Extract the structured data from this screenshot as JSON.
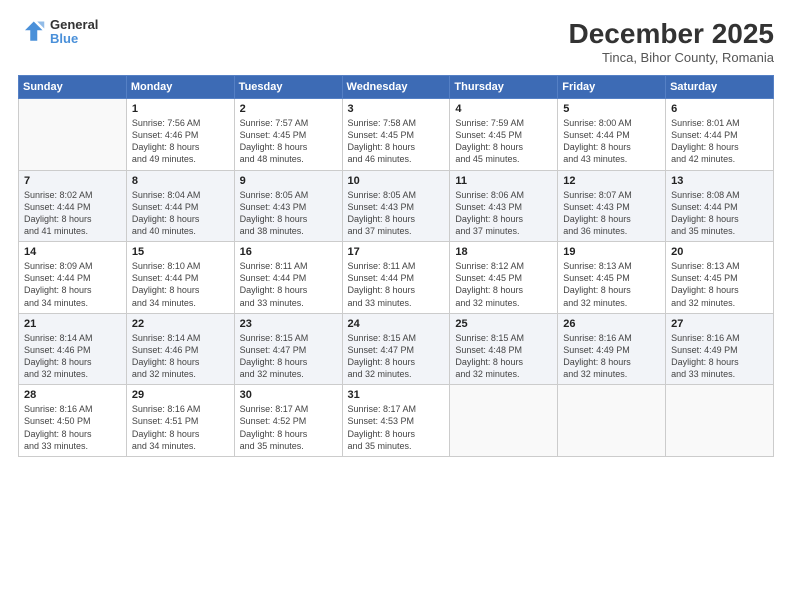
{
  "header": {
    "logo": {
      "general": "General",
      "blue": "Blue"
    },
    "title": "December 2025",
    "location": "Tinca, Bihor County, Romania"
  },
  "days_header": [
    "Sunday",
    "Monday",
    "Tuesday",
    "Wednesday",
    "Thursday",
    "Friday",
    "Saturday"
  ],
  "weeks": [
    [
      {
        "num": "",
        "info": ""
      },
      {
        "num": "1",
        "info": "Sunrise: 7:56 AM\nSunset: 4:46 PM\nDaylight: 8 hours\nand 49 minutes."
      },
      {
        "num": "2",
        "info": "Sunrise: 7:57 AM\nSunset: 4:45 PM\nDaylight: 8 hours\nand 48 minutes."
      },
      {
        "num": "3",
        "info": "Sunrise: 7:58 AM\nSunset: 4:45 PM\nDaylight: 8 hours\nand 46 minutes."
      },
      {
        "num": "4",
        "info": "Sunrise: 7:59 AM\nSunset: 4:45 PM\nDaylight: 8 hours\nand 45 minutes."
      },
      {
        "num": "5",
        "info": "Sunrise: 8:00 AM\nSunset: 4:44 PM\nDaylight: 8 hours\nand 43 minutes."
      },
      {
        "num": "6",
        "info": "Sunrise: 8:01 AM\nSunset: 4:44 PM\nDaylight: 8 hours\nand 42 minutes."
      }
    ],
    [
      {
        "num": "7",
        "info": "Sunrise: 8:02 AM\nSunset: 4:44 PM\nDaylight: 8 hours\nand 41 minutes."
      },
      {
        "num": "8",
        "info": "Sunrise: 8:04 AM\nSunset: 4:44 PM\nDaylight: 8 hours\nand 40 minutes."
      },
      {
        "num": "9",
        "info": "Sunrise: 8:05 AM\nSunset: 4:43 PM\nDaylight: 8 hours\nand 38 minutes."
      },
      {
        "num": "10",
        "info": "Sunrise: 8:05 AM\nSunset: 4:43 PM\nDaylight: 8 hours\nand 37 minutes."
      },
      {
        "num": "11",
        "info": "Sunrise: 8:06 AM\nSunset: 4:43 PM\nDaylight: 8 hours\nand 37 minutes."
      },
      {
        "num": "12",
        "info": "Sunrise: 8:07 AM\nSunset: 4:43 PM\nDaylight: 8 hours\nand 36 minutes."
      },
      {
        "num": "13",
        "info": "Sunrise: 8:08 AM\nSunset: 4:44 PM\nDaylight: 8 hours\nand 35 minutes."
      }
    ],
    [
      {
        "num": "14",
        "info": "Sunrise: 8:09 AM\nSunset: 4:44 PM\nDaylight: 8 hours\nand 34 minutes."
      },
      {
        "num": "15",
        "info": "Sunrise: 8:10 AM\nSunset: 4:44 PM\nDaylight: 8 hours\nand 34 minutes."
      },
      {
        "num": "16",
        "info": "Sunrise: 8:11 AM\nSunset: 4:44 PM\nDaylight: 8 hours\nand 33 minutes."
      },
      {
        "num": "17",
        "info": "Sunrise: 8:11 AM\nSunset: 4:44 PM\nDaylight: 8 hours\nand 33 minutes."
      },
      {
        "num": "18",
        "info": "Sunrise: 8:12 AM\nSunset: 4:45 PM\nDaylight: 8 hours\nand 32 minutes."
      },
      {
        "num": "19",
        "info": "Sunrise: 8:13 AM\nSunset: 4:45 PM\nDaylight: 8 hours\nand 32 minutes."
      },
      {
        "num": "20",
        "info": "Sunrise: 8:13 AM\nSunset: 4:45 PM\nDaylight: 8 hours\nand 32 minutes."
      }
    ],
    [
      {
        "num": "21",
        "info": "Sunrise: 8:14 AM\nSunset: 4:46 PM\nDaylight: 8 hours\nand 32 minutes."
      },
      {
        "num": "22",
        "info": "Sunrise: 8:14 AM\nSunset: 4:46 PM\nDaylight: 8 hours\nand 32 minutes."
      },
      {
        "num": "23",
        "info": "Sunrise: 8:15 AM\nSunset: 4:47 PM\nDaylight: 8 hours\nand 32 minutes."
      },
      {
        "num": "24",
        "info": "Sunrise: 8:15 AM\nSunset: 4:47 PM\nDaylight: 8 hours\nand 32 minutes."
      },
      {
        "num": "25",
        "info": "Sunrise: 8:15 AM\nSunset: 4:48 PM\nDaylight: 8 hours\nand 32 minutes."
      },
      {
        "num": "26",
        "info": "Sunrise: 8:16 AM\nSunset: 4:49 PM\nDaylight: 8 hours\nand 32 minutes."
      },
      {
        "num": "27",
        "info": "Sunrise: 8:16 AM\nSunset: 4:49 PM\nDaylight: 8 hours\nand 33 minutes."
      }
    ],
    [
      {
        "num": "28",
        "info": "Sunrise: 8:16 AM\nSunset: 4:50 PM\nDaylight: 8 hours\nand 33 minutes."
      },
      {
        "num": "29",
        "info": "Sunrise: 8:16 AM\nSunset: 4:51 PM\nDaylight: 8 hours\nand 34 minutes."
      },
      {
        "num": "30",
        "info": "Sunrise: 8:17 AM\nSunset: 4:52 PM\nDaylight: 8 hours\nand 35 minutes."
      },
      {
        "num": "31",
        "info": "Sunrise: 8:17 AM\nSunset: 4:53 PM\nDaylight: 8 hours\nand 35 minutes."
      },
      {
        "num": "",
        "info": ""
      },
      {
        "num": "",
        "info": ""
      },
      {
        "num": "",
        "info": ""
      }
    ]
  ]
}
